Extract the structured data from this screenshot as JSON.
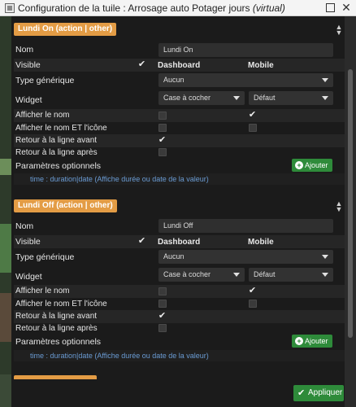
{
  "window": {
    "title_prefix": "Configuration de la tuile : Arrosage auto Potager jours ",
    "title_virtual": "(virtual)",
    "close_glyph": "✕"
  },
  "sections": [
    {
      "command_label": "Lundi On (action | other)",
      "nom_label": "Nom",
      "nom_value": "Lundi On",
      "visible_label": "Visible",
      "dashboard_header": "Dashboard",
      "mobile_header": "Mobile",
      "type_label": "Type générique",
      "type_value": "Aucun",
      "widget_label": "Widget",
      "widget_dashboard_value": "Case à cocher",
      "widget_mobile_value": "Défaut",
      "afficher_nom_label": "Afficher le nom",
      "afficher_nom_icone_label": "Afficher le nom ET l'icône",
      "retour_avant_label": "Retour à la ligne avant",
      "retour_apres_label": "Retour à la ligne après",
      "params_label": "Paramètres optionnels",
      "ajouter_label": "Ajouter",
      "params_hint": "time : duration|date (Affiche durée ou date de la valeur)"
    },
    {
      "command_label": "Lundi Off (action | other)",
      "nom_label": "Nom",
      "nom_value": "Lundi Off",
      "visible_label": "Visible",
      "dashboard_header": "Dashboard",
      "mobile_header": "Mobile",
      "type_label": "Type générique",
      "type_value": "Aucun",
      "widget_label": "Widget",
      "widget_dashboard_value": "Case à cocher",
      "widget_mobile_value": "Défaut",
      "afficher_nom_label": "Afficher le nom",
      "afficher_nom_icone_label": "Afficher le nom ET l'icône",
      "retour_avant_label": "Retour à la ligne avant",
      "retour_apres_label": "Retour à la ligne après",
      "params_label": "Paramètres optionnels",
      "ajouter_label": "Ajouter",
      "params_hint": "time : duration|date (Affiche durée ou date de la valeur)"
    }
  ],
  "apply_label": "Appliquer",
  "colors": {
    "accent_orange": "#e39c45",
    "success_green": "#2e8b3a",
    "hint_blue": "#6a9bd3"
  }
}
